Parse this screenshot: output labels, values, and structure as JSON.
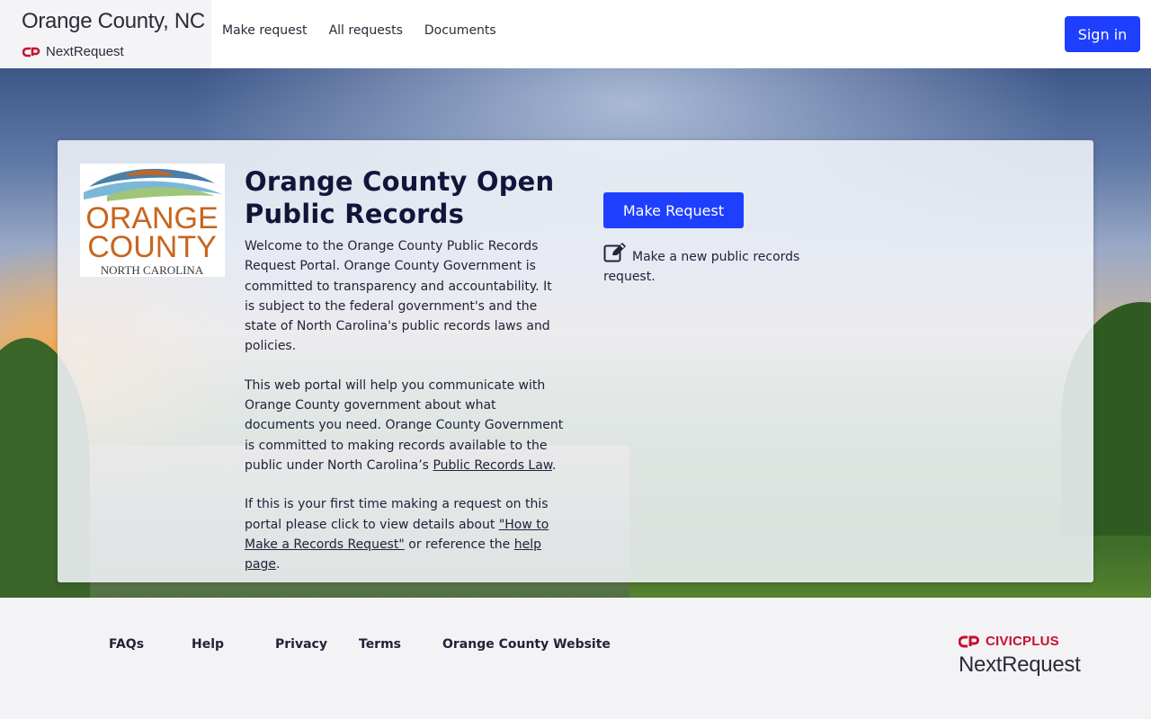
{
  "header": {
    "org_title": "Orange County, NC",
    "product_name": "NextRequest",
    "nav": [
      {
        "label": "Make request"
      },
      {
        "label": "All requests"
      },
      {
        "label": "Documents"
      }
    ],
    "sign_in_label": "Sign in"
  },
  "card": {
    "logo": {
      "line1": "ORANGE",
      "line2": "COUNTY",
      "line3": "NORTH CAROLINA"
    },
    "title": "Orange County Open Public Records",
    "para1": "Welcome to the Orange County Public Records Request Portal. Orange County Government is committed to transparency and accountability. It is subject to the federal government's and the state of North Carolina's public records laws and policies.",
    "para2_text": "This web portal will help you communicate with Orange County government about what documents you need. Orange County Government is committed to making records available to the public under North Carolina’s ",
    "para2_link": "Public Records Law",
    "para2_end": ".",
    "para3_text": "If this is your first time making a request on this portal please click to view details about ",
    "para3_link1": "\"How to Make a Records Request\"",
    "para3_mid": " or reference the ",
    "para3_link2": "help page",
    "para3_end": ".",
    "cta_button_label": "Make Request",
    "cta_description": "Make a new public records request."
  },
  "footer": {
    "links": [
      {
        "label": "FAQs"
      },
      {
        "label": "Help"
      },
      {
        "label": "Privacy"
      },
      {
        "label": "Terms"
      },
      {
        "label": "Orange County Website"
      }
    ],
    "brand_top": "CIVICPLUS",
    "brand_bottom": "NextRequest"
  },
  "colors": {
    "accent": "#1f3fff",
    "brand_red": "#c8102e",
    "logo_orange": "#c8651d"
  },
  "icons": {
    "brand_mark": "civicplus-logo-icon",
    "cta_icon": "edit-icon"
  }
}
